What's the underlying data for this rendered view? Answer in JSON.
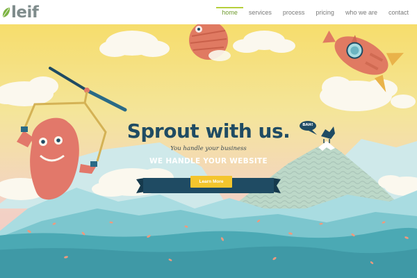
{
  "brand": {
    "name": "leif"
  },
  "nav": {
    "items": [
      {
        "label": "home",
        "active": true
      },
      {
        "label": "services",
        "active": false
      },
      {
        "label": "process",
        "active": false
      },
      {
        "label": "pricing",
        "active": false
      },
      {
        "label": "who we are",
        "active": false
      },
      {
        "label": "contact",
        "active": false
      }
    ]
  },
  "hero": {
    "headline": "Sprout with us.",
    "subheadline": "You handle your business",
    "banner": "WE HANDLE YOUR WEBSITE",
    "cta_label": "Learn More",
    "speech_bubble": "BAH!"
  },
  "colors": {
    "accent": "#b6cf3b",
    "headline": "#1f4b63",
    "banner": "#1f4b63",
    "cta": "#f4c52d",
    "sky_top": "#f6dd6c",
    "sky_bottom": "#f3cfc6",
    "water": "#4ba9b4",
    "monster": "#e2786a"
  },
  "icons": [
    "leaf-logo-icon",
    "propeller-monster",
    "rocket-ship",
    "bird-on-mountain"
  ]
}
